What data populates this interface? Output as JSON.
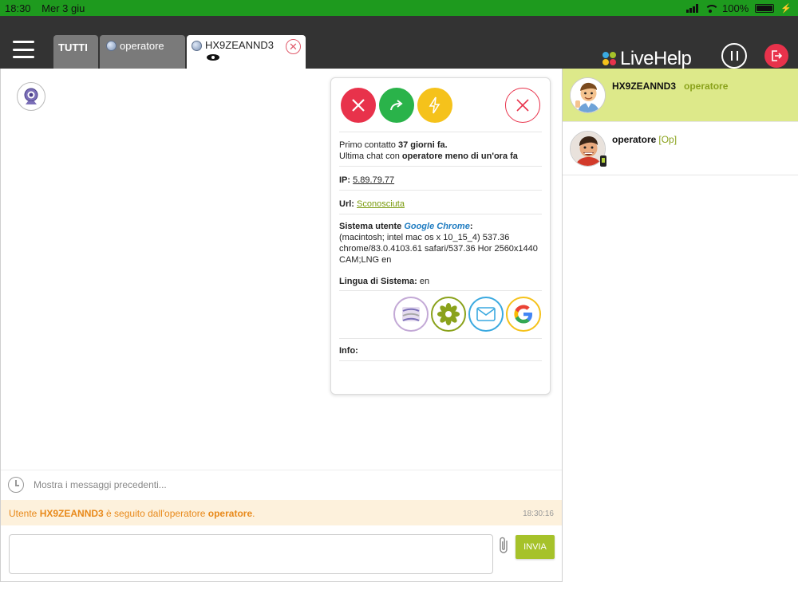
{
  "statusbar": {
    "time": "18:30",
    "date": "Mer 3 giu",
    "battery": "100%"
  },
  "header": {
    "tabs": {
      "all": "TUTTI",
      "operator": "operatore",
      "visitor": "HX9ZEANND3"
    },
    "logo": "LiveHelp"
  },
  "info_panel": {
    "first_contact_prefix": "Primo contatto ",
    "first_contact_value": "37 giorni fa.",
    "last_chat_prefix": "Ultima chat con ",
    "last_chat_value": "operatore meno di un'ora fa",
    "ip_label": "IP:",
    "ip_value": "5.89.79.77",
    "url_label": "Url:",
    "url_value": "Sconosciuta",
    "system_label": "Sistema utente",
    "browser": "Google Chrome",
    "system_colon": ":",
    "system_details": "(macintosh; intel mac os x 10_15_4) 537.36 chrome/83.0.4103.61 safari/537.36 Hor 2560x1440 CAM;LNG en",
    "language_label": "Lingua di Sistema:",
    "language_value": "en",
    "info_label": "Info:"
  },
  "chat": {
    "prev_messages": "Mostra i messaggi precedenti...",
    "notice_prefix": "Utente ",
    "notice_user": "HX9ZEANND3",
    "notice_mid": " è seguito dall'operatore ",
    "notice_operator": "operatore",
    "notice_end": ".",
    "notice_time": "18:30:16",
    "compose_value": "",
    "send_label": "INVIA"
  },
  "sidebar": {
    "items": [
      {
        "name": "HX9ZEANND3",
        "sub": "operatore"
      },
      {
        "name": "operatore",
        "tag": "[Op]"
      }
    ]
  },
  "colors": {
    "status_bar": "#1e9a1e",
    "header": "#333333",
    "accent_green": "#a6c22a",
    "active_item": "#dde98a",
    "notice_bg": "#fdf1dc",
    "notice_text": "#e8891a",
    "red": "#e8324b",
    "green": "#2ab34a",
    "yellow": "#f5c21b"
  },
  "icons": {
    "menu": "hamburger-icon",
    "pause": "pause-icon",
    "logout": "logout-icon",
    "webcam": "webcam-icon",
    "reject": "close-icon",
    "forward": "forward-icon",
    "quick": "lightning-icon",
    "attach": "paperclip-icon"
  }
}
